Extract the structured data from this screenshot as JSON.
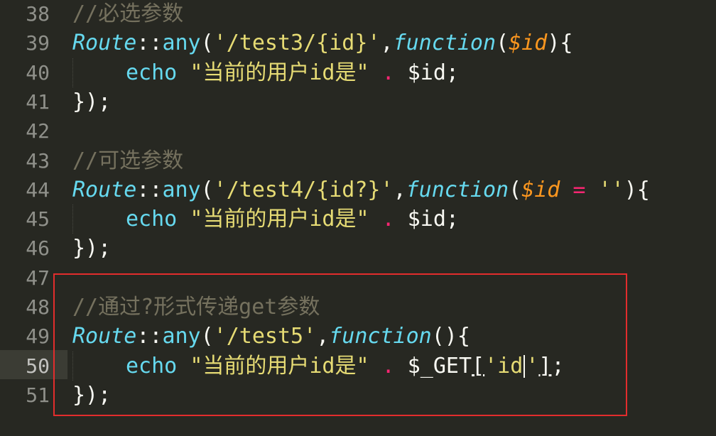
{
  "lines": [
    {
      "n": "38",
      "tokens": [
        {
          "t": "//必选参数",
          "c": "cmt"
        }
      ]
    },
    {
      "n": "39",
      "tokens": [
        {
          "t": "Route",
          "c": "cls"
        },
        {
          "t": "::",
          "c": "pl"
        },
        {
          "t": "any",
          "c": "fn"
        },
        {
          "t": "(",
          "c": "pl"
        },
        {
          "t": "'/test3/{id}'",
          "c": "str"
        },
        {
          "t": ",",
          "c": "pl"
        },
        {
          "t": "function",
          "c": "kw"
        },
        {
          "t": "(",
          "c": "pl"
        },
        {
          "t": "$id",
          "c": "var"
        },
        {
          "t": "){",
          "c": "pl"
        }
      ]
    },
    {
      "n": "40",
      "tokens": [
        {
          "t": "echo ",
          "c": "fn"
        },
        {
          "t": "\"当前的用户id是\"",
          "c": "str"
        },
        {
          "t": " . ",
          "c": "op"
        },
        {
          "t": "$id;",
          "c": "pl"
        }
      ]
    },
    {
      "n": "41",
      "tokens": [
        {
          "t": "});",
          "c": "pl"
        }
      ]
    },
    {
      "n": "42",
      "tokens": []
    },
    {
      "n": "43",
      "tokens": [
        {
          "t": "//可选参数",
          "c": "cmt"
        }
      ]
    },
    {
      "n": "44",
      "tokens": [
        {
          "t": "Route",
          "c": "cls"
        },
        {
          "t": "::",
          "c": "pl"
        },
        {
          "t": "any",
          "c": "fn"
        },
        {
          "t": "(",
          "c": "pl"
        },
        {
          "t": "'/test4/{id?}'",
          "c": "str"
        },
        {
          "t": ",",
          "c": "pl"
        },
        {
          "t": "function",
          "c": "kw"
        },
        {
          "t": "(",
          "c": "pl"
        },
        {
          "t": "$id",
          "c": "var"
        },
        {
          "t": " = ",
          "c": "op"
        },
        {
          "t": "''",
          "c": "str"
        },
        {
          "t": "){",
          "c": "pl"
        }
      ]
    },
    {
      "n": "45",
      "tokens": [
        {
          "t": "echo ",
          "c": "fn"
        },
        {
          "t": "\"当前的用户id是\"",
          "c": "str"
        },
        {
          "t": " . ",
          "c": "op"
        },
        {
          "t": "$id;",
          "c": "pl"
        }
      ]
    },
    {
      "n": "46",
      "tokens": [
        {
          "t": "});",
          "c": "pl"
        }
      ]
    },
    {
      "n": "47",
      "tokens": []
    },
    {
      "n": "48",
      "tokens": [
        {
          "t": "//通过?形式传递get参数",
          "c": "cmt"
        }
      ]
    },
    {
      "n": "49",
      "tokens": [
        {
          "t": "Route",
          "c": "cls"
        },
        {
          "t": "::",
          "c": "pl"
        },
        {
          "t": "any",
          "c": "fn"
        },
        {
          "t": "(",
          "c": "pl"
        },
        {
          "t": "'/test5'",
          "c": "str"
        },
        {
          "t": ",",
          "c": "pl"
        },
        {
          "t": "function",
          "c": "kw"
        },
        {
          "t": "(){",
          "c": "pl"
        }
      ]
    },
    {
      "n": "50",
      "tokens": [
        {
          "t": "echo ",
          "c": "fn"
        },
        {
          "t": "\"当前的用户id是\"",
          "c": "str"
        },
        {
          "t": " . ",
          "c": "op"
        },
        {
          "t": "$_GET",
          "c": "pl"
        },
        {
          "t": "[",
          "c": "pl",
          "u": true
        },
        {
          "t": "'id",
          "c": "str"
        },
        {
          "t": "|",
          "c": "cursor"
        },
        {
          "t": "'",
          "c": "str"
        },
        {
          "t": "]",
          "c": "pl",
          "u": true
        },
        {
          "t": ";",
          "c": "pl"
        }
      ]
    },
    {
      "n": "51",
      "tokens": [
        {
          "t": "});",
          "c": "pl"
        }
      ]
    }
  ],
  "indented_lines": [
    "40",
    "45",
    "50"
  ],
  "current_line": "50",
  "colors": {
    "background": "#272822",
    "comment": "#75715e",
    "string": "#e6db74",
    "keyword": "#66d9ef",
    "variable": "#fd971f",
    "operator": "#f92672",
    "annotation_box": "#e22d2d"
  }
}
